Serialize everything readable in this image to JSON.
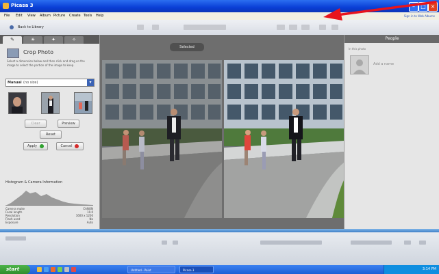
{
  "window": {
    "title": "Picasa 3"
  },
  "menu": {
    "items": [
      "File",
      "Edit",
      "View",
      "Album",
      "Picture",
      "Create",
      "Tools",
      "Help"
    ],
    "sign_in": "Sign in to Web Albums"
  },
  "toolbar": {
    "back_label": "Back to Library"
  },
  "left_panel": {
    "heading": "Crop Photo",
    "description": "Select a dimension below and then click and drag on the image to select the portion of the image to keep.",
    "manual_label": "Manual",
    "manual_value": "(no size)",
    "buttons": {
      "clear": "Clear",
      "preview": "Preview",
      "reset": "Reset",
      "apply": "Apply",
      "cancel": "Cancel"
    },
    "histogram_title": "Histogram & Camera Information",
    "info": [
      {
        "k": "Camera make",
        "v": "CANON"
      },
      {
        "k": "Focal length",
        "v": "10.0"
      },
      {
        "k": "Resolution",
        "v": "1600 x 1200"
      },
      {
        "k": "Flash used",
        "v": "No"
      },
      {
        "k": "Exposure",
        "v": "Auto"
      }
    ]
  },
  "main": {
    "selected_label": "Selected"
  },
  "right_panel": {
    "header": "People",
    "sub": "In this photo",
    "person_name": "Add a name"
  },
  "taskbar": {
    "start": "start",
    "tasks": [
      "Untitled - Paint",
      "Picasa 3"
    ],
    "clock": "3:14 PM"
  },
  "colors": {
    "title_bar": "#0a3fd6",
    "annotation_arrow": "#e8141c",
    "taskbar": "#1d5fd6",
    "start_button": "#2f8e2c"
  }
}
